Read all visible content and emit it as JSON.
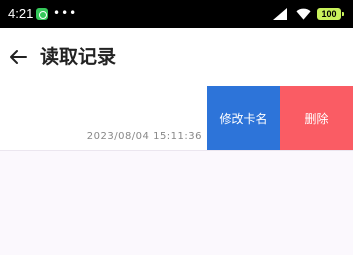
{
  "status_bar": {
    "time": "4:21",
    "more": "•••",
    "battery": "100",
    "app_icon": "chat-bubble-icon",
    "signal_icon": "signal-icon",
    "wifi_icon": "wifi-icon",
    "battery_color": "#c9f25c"
  },
  "app_bar": {
    "back_icon": "arrow-left-icon",
    "title": "读取记录"
  },
  "records": [
    {
      "time": "2023/08/04 15:11:36",
      "actions": {
        "rename": "修改卡名",
        "delete": "删除"
      }
    }
  ],
  "colors": {
    "rename_action": "#2d74d9",
    "delete_action": "#fa5c64",
    "list_background": "#fbf8fd"
  }
}
